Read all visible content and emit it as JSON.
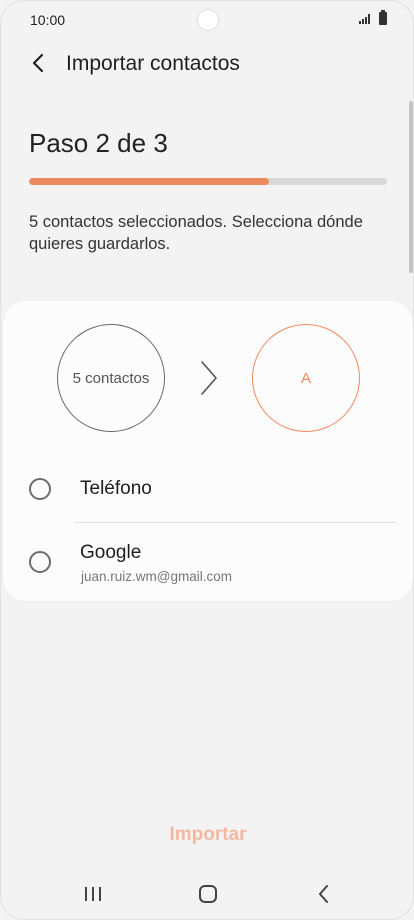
{
  "status_bar": {
    "time": "10:00"
  },
  "header": {
    "title": "Importar contactos"
  },
  "step": {
    "title": "Paso 2 de 3",
    "progress_percent": 67
  },
  "description": "5 contactos seleccionados. Selecciona dónde quieres guardarlos.",
  "transfer": {
    "source_label": "5 contactos",
    "destination_label": "A"
  },
  "options": [
    {
      "label": "Teléfono",
      "sub": ""
    },
    {
      "label": "Google",
      "sub": "juan.ruiz.wm@gmail.com"
    }
  ],
  "footer": {
    "import_label": "Importar"
  },
  "colors": {
    "accent": "#ef8a5e",
    "accent_disabled": "#f3b9a0"
  },
  "icons": [
    "signal-icon",
    "battery-icon",
    "back-arrow-icon",
    "chevron-right-icon",
    "recent-apps-icon",
    "home-icon",
    "back-icon"
  ]
}
